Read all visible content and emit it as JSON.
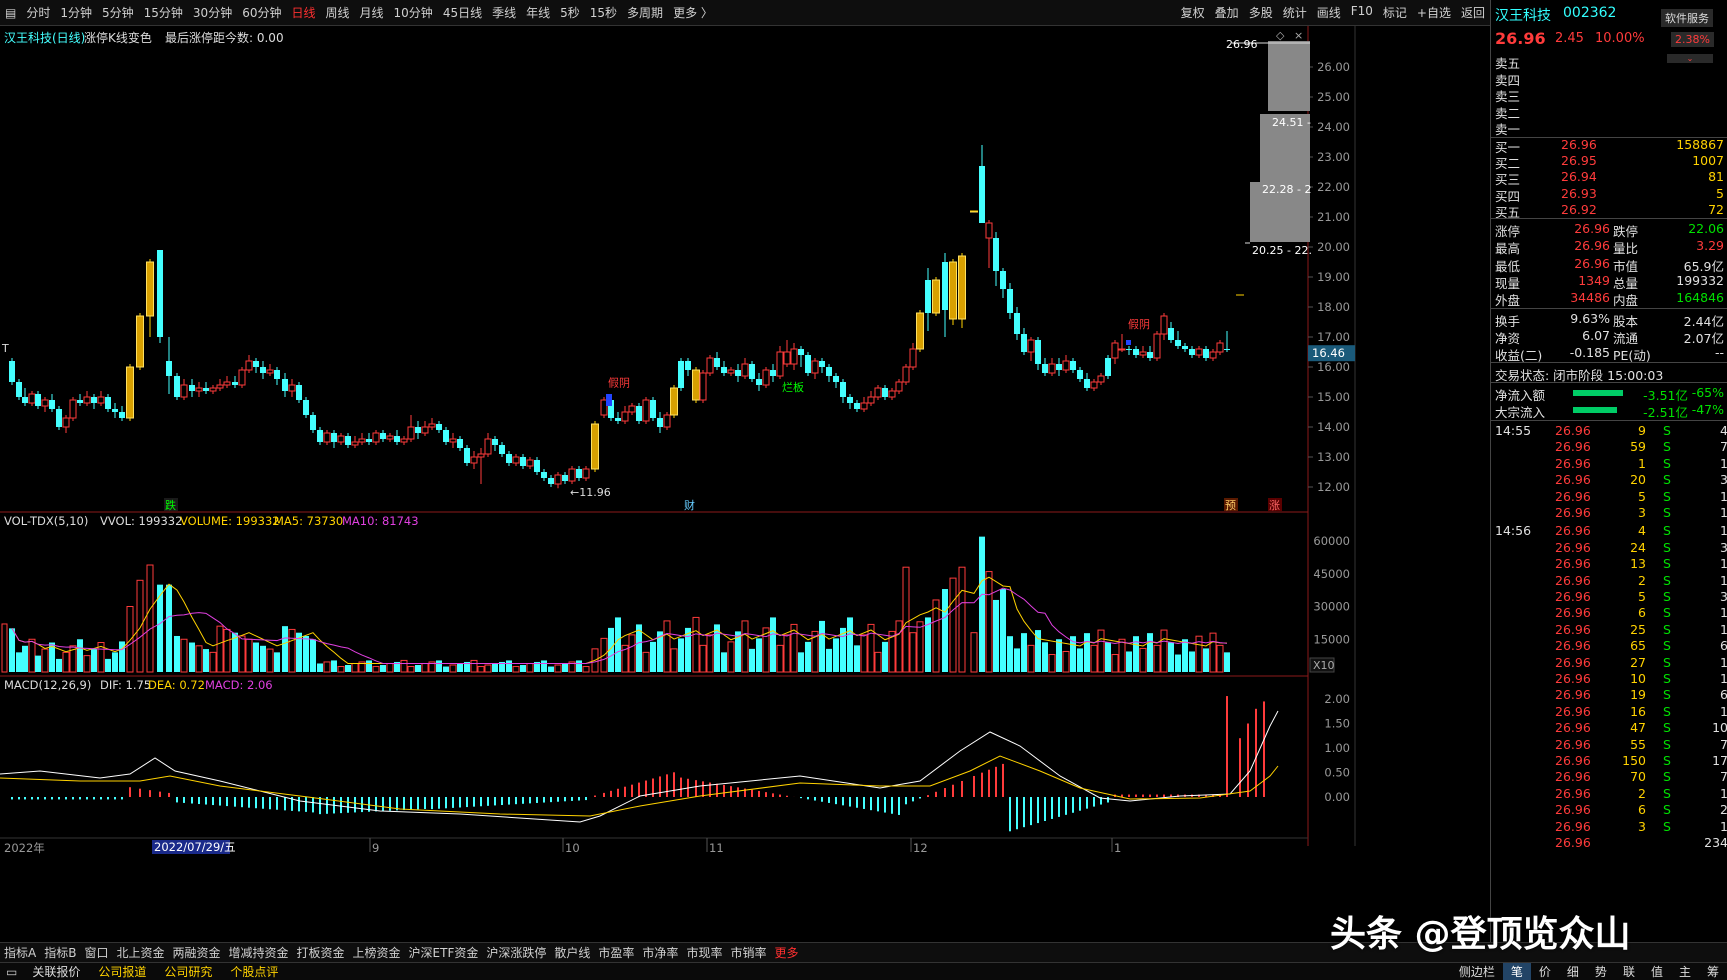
{
  "toolbar": {
    "periods": [
      "分时",
      "1分钟",
      "5分钟",
      "15分钟",
      "30分钟",
      "60分钟",
      "日线",
      "周线",
      "月线",
      "10分钟",
      "45日线",
      "季线",
      "年线",
      "5秒",
      "15秒",
      "多周期",
      "更多 〉"
    ],
    "active_period": "日线",
    "right_items": [
      "复权",
      "叠加",
      "多股",
      "统计",
      "画线",
      "F10",
      "标记",
      "+自选",
      "返回"
    ]
  },
  "main_chart": {
    "title": "汉王科技(日线)",
    "indicator_text": "涨停K线变色",
    "indicator_value": "最后涨停距今数: 0.00",
    "price_axis": [
      "26.00",
      "25.00",
      "24.00",
      "23.00",
      "22.00",
      "21.00",
      "20.00",
      "19.00",
      "18.00",
      "17.00",
      "16.00",
      "15.00",
      "14.00",
      "13.00",
      "12.00"
    ],
    "current_price_tag": "16.46",
    "low_annotation": "←11.96",
    "labels": {
      "fall": "跌",
      "finance": "财",
      "board": "烂板",
      "yin1": "假阴",
      "yin2": "假阴",
      "predict": "预",
      "rise": "涨"
    },
    "chip_labels": [
      "26.96",
      "24.51 -",
      "22.28 - 2",
      "20.25 - 22."
    ]
  },
  "vol_panel": {
    "title": "VOL-TDX(5,10)",
    "vvol": "VVOL: 199332",
    "volume": "VOLUME: 199332",
    "ma5": "MA5: 73730",
    "ma10": "MA10: 81743",
    "axis": [
      "60000",
      "45000",
      "30000",
      "15000"
    ],
    "unit": "X10"
  },
  "macd_panel": {
    "title": "MACD(12,26,9)",
    "dif": "DIF: 1.75",
    "dea": "DEA: 0.72",
    "macd": "MACD: 2.06",
    "axis": [
      "2.00",
      "1.50",
      "1.00",
      "0.50",
      "0.00"
    ]
  },
  "date_axis": {
    "year": "2022年",
    "cursor_date": "2022/07/29/五",
    "months": [
      "9",
      "10",
      "11",
      "12",
      "1"
    ]
  },
  "stock": {
    "name": "汉王科技",
    "code": "002362",
    "service": "软件服务",
    "price": "26.96",
    "change": "2.45",
    "change_pct": "10.00%",
    "amp": "2.38%"
  },
  "asks": [
    {
      "label": "卖五",
      "price": "",
      "vol": ""
    },
    {
      "label": "卖四",
      "price": "",
      "vol": ""
    },
    {
      "label": "卖三",
      "price": "",
      "vol": ""
    },
    {
      "label": "卖二",
      "price": "",
      "vol": ""
    },
    {
      "label": "卖一",
      "price": "",
      "vol": ""
    }
  ],
  "bids": [
    {
      "label": "买一",
      "price": "26.96",
      "vol": "158867"
    },
    {
      "label": "买二",
      "price": "26.95",
      "vol": "1007"
    },
    {
      "label": "买三",
      "price": "26.94",
      "vol": "81"
    },
    {
      "label": "买四",
      "price": "26.93",
      "vol": "5"
    },
    {
      "label": "买五",
      "price": "26.92",
      "vol": "72"
    }
  ],
  "stats": [
    {
      "l1": "涨停",
      "v1": "26.96",
      "c1": "red",
      "l2": "跌停",
      "v2": "22.06",
      "c2": "green"
    },
    {
      "l1": "最高",
      "v1": "26.96",
      "c1": "red",
      "l2": "量比",
      "v2": "3.29",
      "c2": "red"
    },
    {
      "l1": "最低",
      "v1": "26.96",
      "c1": "red",
      "l2": "市值",
      "v2": "65.9亿",
      "c2": "white"
    },
    {
      "l1": "现量",
      "v1": "1349",
      "c1": "red",
      "l2": "总量",
      "v2": "199332",
      "c2": "white"
    },
    {
      "l1": "外盘",
      "v1": "34486",
      "c1": "red",
      "l2": "内盘",
      "v2": "164846",
      "c2": "green"
    },
    {
      "l1": "换手",
      "v1": "9.63%",
      "c1": "white",
      "l2": "股本",
      "v2": "2.44亿",
      "c2": "white"
    },
    {
      "l1": "净资",
      "v1": "6.07",
      "c1": "white",
      "l2": "流通",
      "v2": "2.07亿",
      "c2": "white"
    },
    {
      "l1": "收益(二)",
      "v1": "-0.185",
      "c1": "white",
      "l2": "PE(动)",
      "v2": "--",
      "c2": "white"
    }
  ],
  "trade_state": "交易状态: 闭市阶段 15:00:03",
  "flows": [
    {
      "label": "净流入额",
      "value": "-3.51亿",
      "pct": "-65%"
    },
    {
      "label": "大宗流入",
      "value": "-2.51亿",
      "pct": "-47%"
    }
  ],
  "ticks": [
    {
      "time": "14:55",
      "price": "26.96",
      "vol": "9",
      "side": "S",
      "n": "4"
    },
    {
      "time": "",
      "price": "26.96",
      "vol": "59",
      "side": "S",
      "n": "7"
    },
    {
      "time": "",
      "price": "26.96",
      "vol": "1",
      "side": "S",
      "n": "1"
    },
    {
      "time": "",
      "price": "26.96",
      "vol": "20",
      "side": "S",
      "n": "3"
    },
    {
      "time": "",
      "price": "26.96",
      "vol": "5",
      "side": "S",
      "n": "1"
    },
    {
      "time": "",
      "price": "26.96",
      "vol": "3",
      "side": "S",
      "n": "1"
    },
    {
      "time": "14:56",
      "price": "26.96",
      "vol": "4",
      "side": "S",
      "n": "1"
    },
    {
      "time": "",
      "price": "26.96",
      "vol": "24",
      "side": "S",
      "n": "3"
    },
    {
      "time": "",
      "price": "26.96",
      "vol": "13",
      "side": "S",
      "n": "1"
    },
    {
      "time": "",
      "price": "26.96",
      "vol": "2",
      "side": "S",
      "n": "1"
    },
    {
      "time": "",
      "price": "26.96",
      "vol": "5",
      "side": "S",
      "n": "3"
    },
    {
      "time": "",
      "price": "26.96",
      "vol": "6",
      "side": "S",
      "n": "1"
    },
    {
      "time": "",
      "price": "26.96",
      "vol": "25",
      "side": "S",
      "n": "1"
    },
    {
      "time": "",
      "price": "26.96",
      "vol": "65",
      "side": "S",
      "n": "6"
    },
    {
      "time": "",
      "price": "26.96",
      "vol": "27",
      "side": "S",
      "n": "1"
    },
    {
      "time": "",
      "price": "26.96",
      "vol": "10",
      "side": "S",
      "n": "1"
    },
    {
      "time": "",
      "price": "26.96",
      "vol": "19",
      "side": "S",
      "n": "6"
    },
    {
      "time": "",
      "price": "26.96",
      "vol": "16",
      "side": "S",
      "n": "1"
    },
    {
      "time": "",
      "price": "26.96",
      "vol": "47",
      "side": "S",
      "n": "10"
    },
    {
      "time": "",
      "price": "26.96",
      "vol": "55",
      "side": "S",
      "n": "7"
    },
    {
      "time": "",
      "price": "26.96",
      "vol": "150",
      "side": "S",
      "n": "17"
    },
    {
      "time": "",
      "price": "26.96",
      "vol": "70",
      "side": "S",
      "n": "7"
    },
    {
      "time": "",
      "price": "26.96",
      "vol": "2",
      "side": "S",
      "n": "1"
    },
    {
      "time": "",
      "price": "26.96",
      "vol": "6",
      "side": "S",
      "n": "2"
    },
    {
      "time": "",
      "price": "26.96",
      "vol": "3",
      "side": "S",
      "n": "1"
    },
    {
      "time": "",
      "price": "26.96",
      "vol": "",
      "side": "",
      "n": "234"
    }
  ],
  "bottom_tabs": [
    "指标A",
    "指标B",
    "窗口",
    "北上资金",
    "两融资金",
    "增减持资金",
    "打板资金",
    "上榜资金",
    "沪深ETF资金",
    "沪深涨跌停",
    "散户线",
    "市盈率",
    "市净率",
    "市现率",
    "市销率",
    "更多"
  ],
  "bottom_links": [
    "关联报价",
    "公司报道",
    "公司研究",
    "个股点评"
  ],
  "side_tabs": [
    "侧边栏",
    "笔",
    "价",
    "细",
    "势",
    "联",
    "值",
    "主",
    "筹"
  ],
  "watermark": "头条 @登顶览众山"
}
